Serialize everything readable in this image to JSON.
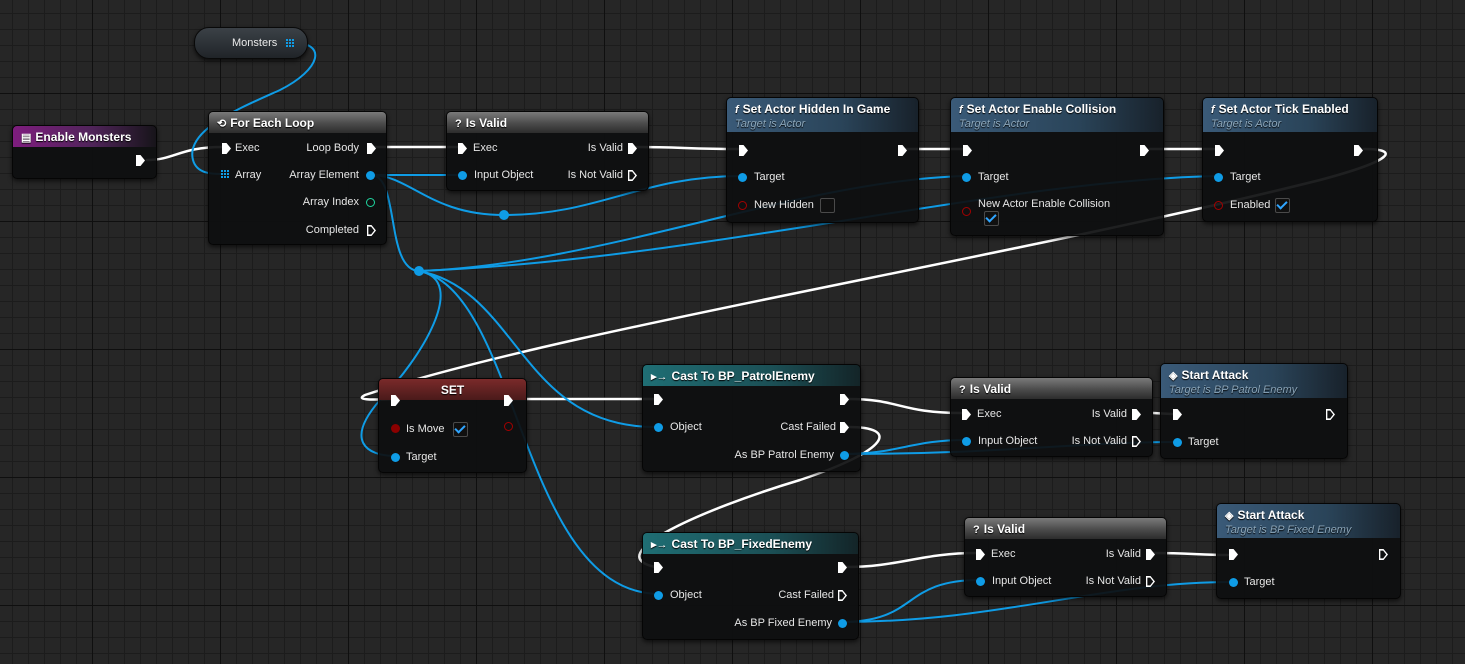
{
  "colors": {
    "exec": "#ffffff",
    "object": "#0f9ce6",
    "boolean": "#8b0000",
    "integer": "#1fd6a0",
    "event_header": "#7e1d7e",
    "function_header": "#3a5a78",
    "cast_header": "#1f6e74"
  },
  "variable": {
    "label": "Monsters",
    "icon": "array-grid-icon"
  },
  "event": {
    "title": "Enable Monsters",
    "icon": "event-icon"
  },
  "for_each": {
    "title": "For Each Loop",
    "icon": "loop-icon",
    "exec": "Exec",
    "array": "Array",
    "loop_body": "Loop Body",
    "array_element": "Array Element",
    "array_index": "Array Index",
    "completed": "Completed"
  },
  "is_valid_1": {
    "title": "Is Valid",
    "icon": "question-icon",
    "exec": "Exec",
    "input_object": "Input Object",
    "is_valid": "Is Valid",
    "is_not_valid": "Is Not Valid"
  },
  "set_hidden": {
    "title": "Set Actor Hidden In Game",
    "subtitle": "Target is Actor",
    "icon": "function-icon",
    "target": "Target",
    "param": "New Hidden",
    "param_checked": false
  },
  "set_collision": {
    "title": "Set Actor Enable Collision",
    "subtitle": "Target is Actor",
    "icon": "function-icon",
    "target": "Target",
    "param": "New Actor Enable Collision",
    "param_checked": true
  },
  "set_tick": {
    "title": "Set Actor Tick Enabled",
    "subtitle": "Target is Actor",
    "icon": "function-icon",
    "target": "Target",
    "param": "Enabled",
    "param_checked": true
  },
  "set_node": {
    "title": "SET",
    "param": "Is Move",
    "param_checked": true,
    "target": "Target"
  },
  "cast_patrol": {
    "title": "Cast To BP_PatrolEnemy",
    "icon": "cast-icon",
    "object": "Object",
    "cast_failed": "Cast Failed",
    "as_output": "As BP Patrol Enemy"
  },
  "cast_fixed": {
    "title": "Cast To BP_FixedEnemy",
    "icon": "cast-icon",
    "object": "Object",
    "cast_failed": "Cast Failed",
    "as_output": "As BP Fixed Enemy"
  },
  "is_valid_2": {
    "title": "Is Valid",
    "icon": "question-icon",
    "exec": "Exec",
    "input_object": "Input Object",
    "is_valid": "Is Valid",
    "is_not_valid": "Is Not Valid"
  },
  "is_valid_3": {
    "title": "Is Valid",
    "icon": "question-icon",
    "exec": "Exec",
    "input_object": "Input Object",
    "is_valid": "Is Valid",
    "is_not_valid": "Is Not Valid"
  },
  "start_attack_patrol": {
    "title": "Start Attack",
    "subtitle": "Target is BP Patrol Enemy",
    "icon": "message-icon",
    "target": "Target"
  },
  "start_attack_fixed": {
    "title": "Start Attack",
    "subtitle": "Target is BP Fixed Enemy",
    "icon": "message-icon",
    "target": "Target"
  }
}
